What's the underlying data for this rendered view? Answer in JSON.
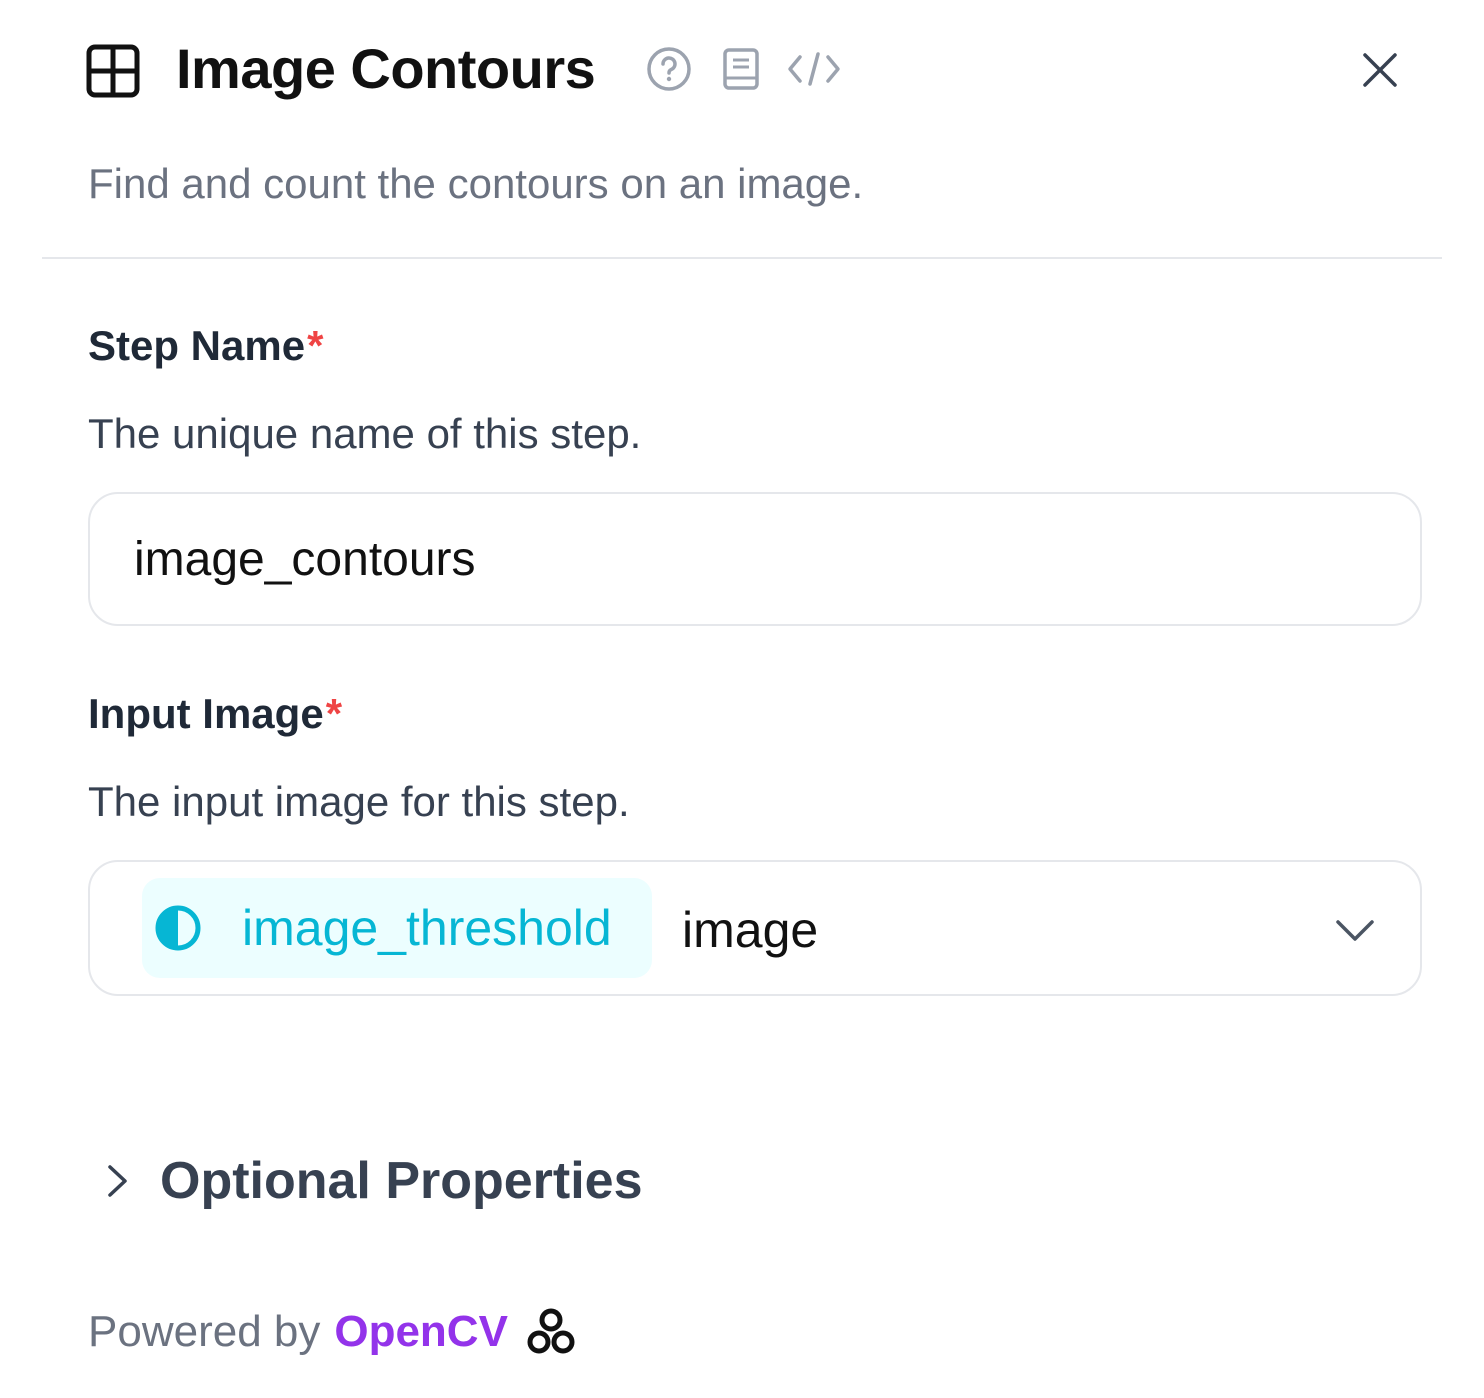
{
  "header": {
    "title": "Image Contours",
    "subtitle": "Find and count the contours on an image.",
    "icons": [
      "block-grid-icon",
      "help-circle-icon",
      "docs-book-icon",
      "code-icon",
      "close-icon"
    ]
  },
  "step_name": {
    "label": "Step Name",
    "required_mark": "*",
    "description": "The unique name of this step.",
    "value": "image_contours"
  },
  "input_image": {
    "label": "Input Image",
    "required_mark": "*",
    "description": "The input image for this step.",
    "chip_label": "image_threshold",
    "chip_icon": "half-circle-icon",
    "value": "image"
  },
  "optional": {
    "label": "Optional Properties"
  },
  "footer": {
    "prefix": "Powered by",
    "brand": "OpenCV"
  },
  "colors": {
    "required": "#ef4444",
    "chip_bg": "#ecfeff",
    "chip_text": "#06b6d4",
    "brand": "#9333ea",
    "muted_text": "#6b7280",
    "border": "#e5e7eb"
  }
}
